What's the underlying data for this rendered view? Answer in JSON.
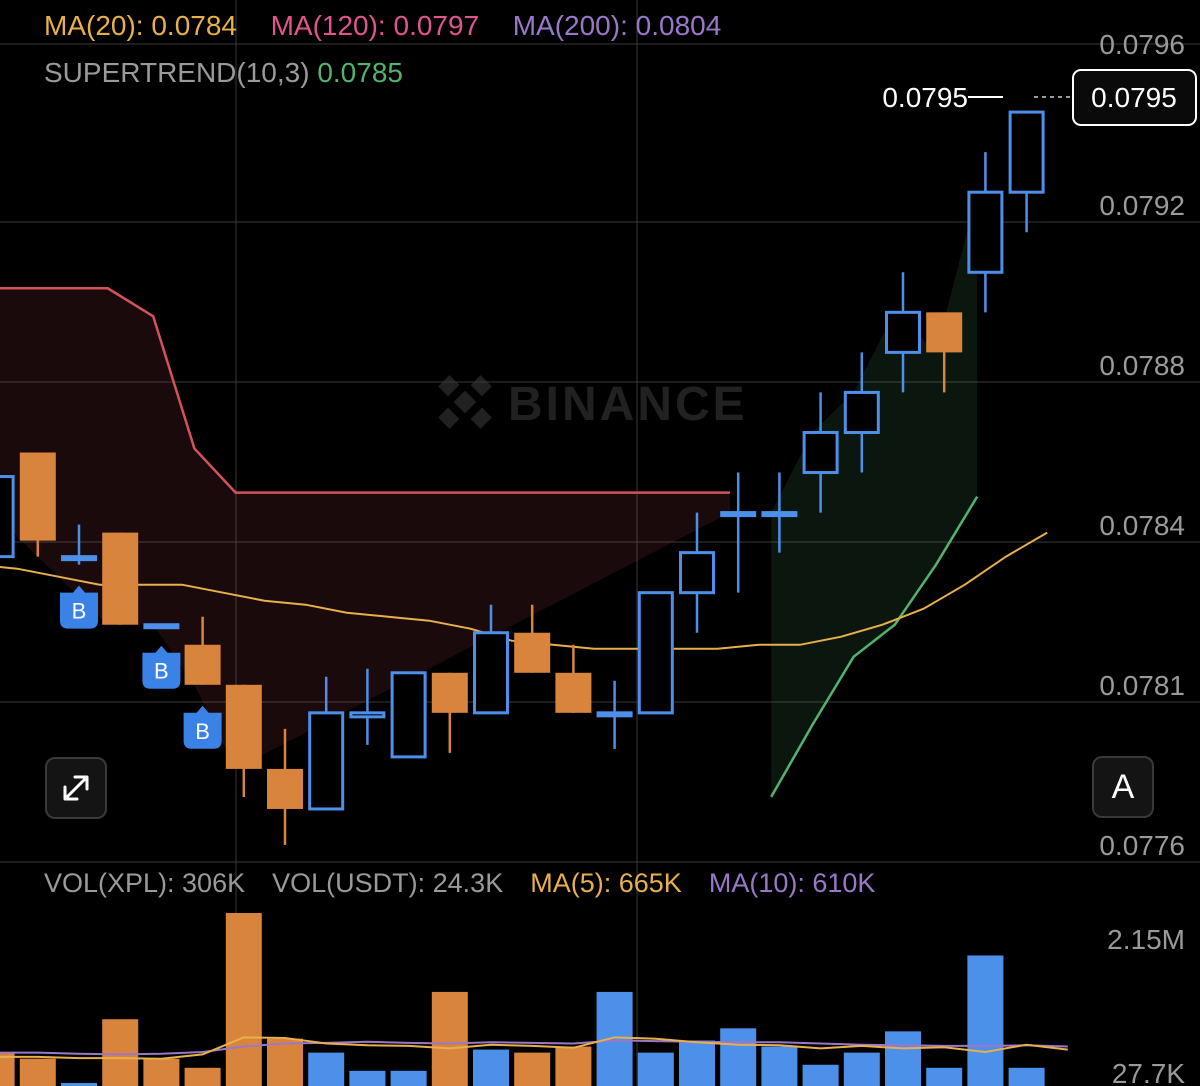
{
  "indicators": {
    "ma20": {
      "label": "MA(20): ",
      "value": "0.0784",
      "color": "#e8b04a"
    },
    "ma120": {
      "label": "MA(120): ",
      "value": "0.0797",
      "color": "#e0558f"
    },
    "ma200": {
      "label": "MA(200): ",
      "value": "0.0804",
      "color": "#9a78c8"
    },
    "supertrend": {
      "label": "SUPERTREND(10,3) ",
      "value": "0.0785",
      "label_color": "#9a9a9a",
      "value_color": "#52b46c"
    }
  },
  "volume_header": {
    "vol_xpl": "VOL(XPL): 306K",
    "vol_usdt": "VOL(USDT): 24.3K",
    "ma5": "MA(5): 665K",
    "ma10": "MA(10): 610K"
  },
  "watermark": "BINANCE",
  "current_price": {
    "label": "0.0795",
    "tag": "0.0795"
  },
  "auto_button": {
    "label": "A"
  },
  "expand_button": {
    "icon": "expand-icon"
  },
  "colors": {
    "up": "#4c90ea",
    "down": "#d8843c",
    "supertrend_up": "#52b46c",
    "supertrend_down": "#d6525a",
    "ma_line": "#e8b04a",
    "vol_ma10": "#9a78c8",
    "grid": "#3a3a3a",
    "axis_text": "#9a9a9a",
    "buy_marker": "#3b82e6"
  },
  "chart_data": {
    "type": "candlestick",
    "price_axis": {
      "ticks": [
        "0.0796",
        "0.0792",
        "0.0788",
        "0.0784",
        "0.0781",
        "0.0776"
      ]
    },
    "volume_axis": {
      "ticks": [
        "2.15M",
        "27.7K"
      ]
    },
    "candles": [
      {
        "o": 0.07832,
        "c": 0.07852,
        "h": 0.07852,
        "l": 0.07832
      },
      {
        "o": 0.07858,
        "c": 0.07836,
        "h": 0.07858,
        "l": 0.07832
      },
      {
        "o": 0.07832,
        "c": 0.07832,
        "h": 0.0784,
        "l": 0.0783
      },
      {
        "o": 0.07838,
        "c": 0.07815,
        "h": 0.07838,
        "l": 0.07815
      },
      {
        "o": 0.07815,
        "c": 0.07815,
        "h": 0.07815,
        "l": 0.07815
      },
      {
        "o": 0.0781,
        "c": 0.078,
        "h": 0.07817,
        "l": 0.078
      },
      {
        "o": 0.078,
        "c": 0.07779,
        "h": 0.078,
        "l": 0.07772
      },
      {
        "o": 0.07779,
        "c": 0.07769,
        "h": 0.07789,
        "l": 0.0776
      },
      {
        "o": 0.07769,
        "c": 0.07793,
        "h": 0.07802,
        "l": 0.07769
      },
      {
        "o": 0.07792,
        "c": 0.07793,
        "h": 0.07804,
        "l": 0.07785
      },
      {
        "o": 0.07782,
        "c": 0.07803,
        "h": 0.07803,
        "l": 0.07782
      },
      {
        "o": 0.07803,
        "c": 0.07793,
        "h": 0.07803,
        "l": 0.07783
      },
      {
        "o": 0.07793,
        "c": 0.07813,
        "h": 0.0782,
        "l": 0.07793
      },
      {
        "o": 0.07813,
        "c": 0.07803,
        "h": 0.0782,
        "l": 0.07803
      },
      {
        "o": 0.07803,
        "c": 0.07793,
        "h": 0.0781,
        "l": 0.07793
      },
      {
        "o": 0.07793,
        "c": 0.07793,
        "h": 0.07801,
        "l": 0.07784
      },
      {
        "o": 0.07793,
        "c": 0.07823,
        "h": 0.07823,
        "l": 0.07793
      },
      {
        "o": 0.07823,
        "c": 0.07833,
        "h": 0.07843,
        "l": 0.07813
      },
      {
        "o": 0.07843,
        "c": 0.07843,
        "h": 0.07853,
        "l": 0.07823
      },
      {
        "o": 0.07843,
        "c": 0.07843,
        "h": 0.07853,
        "l": 0.07833
      },
      {
        "o": 0.07853,
        "c": 0.07863,
        "h": 0.07873,
        "l": 0.07843
      },
      {
        "o": 0.07863,
        "c": 0.07873,
        "h": 0.07883,
        "l": 0.07853
      },
      {
        "o": 0.07883,
        "c": 0.07893,
        "h": 0.07903,
        "l": 0.07873
      },
      {
        "o": 0.07893,
        "c": 0.07883,
        "h": 0.07893,
        "l": 0.07873
      },
      {
        "o": 0.07903,
        "c": 0.07923,
        "h": 0.07933,
        "l": 0.07893
      },
      {
        "o": 0.07923,
        "c": 0.07943,
        "h": 0.07943,
        "l": 0.07913
      }
    ],
    "volumes": [
      {
        "v": 0.55,
        "dir": "down"
      },
      {
        "v": 0.45,
        "dir": "down"
      },
      {
        "v": 0.05,
        "dir": "up"
      },
      {
        "v": 1.1,
        "dir": "down"
      },
      {
        "v": 0.45,
        "dir": "down"
      },
      {
        "v": 0.3,
        "dir": "down"
      },
      {
        "v": 2.85,
        "dir": "down"
      },
      {
        "v": 0.78,
        "dir": "down"
      },
      {
        "v": 0.55,
        "dir": "up"
      },
      {
        "v": 0.25,
        "dir": "up"
      },
      {
        "v": 0.25,
        "dir": "up"
      },
      {
        "v": 1.55,
        "dir": "down"
      },
      {
        "v": 0.6,
        "dir": "up"
      },
      {
        "v": 0.55,
        "dir": "down"
      },
      {
        "v": 0.65,
        "dir": "down"
      },
      {
        "v": 1.55,
        "dir": "up"
      },
      {
        "v": 0.55,
        "dir": "up"
      },
      {
        "v": 0.75,
        "dir": "up"
      },
      {
        "v": 0.95,
        "dir": "up"
      },
      {
        "v": 0.65,
        "dir": "up"
      },
      {
        "v": 0.35,
        "dir": "up"
      },
      {
        "v": 0.55,
        "dir": "up"
      },
      {
        "v": 0.9,
        "dir": "up"
      },
      {
        "v": 0.3,
        "dir": "up"
      },
      {
        "v": 2.15,
        "dir": "up"
      },
      {
        "v": 0.3,
        "dir": "up"
      }
    ],
    "vol_ma5": [
      0.48,
      0.48,
      0.46,
      0.46,
      0.45,
      0.52,
      0.8,
      0.79,
      0.7,
      0.67,
      0.66,
      0.62,
      0.68,
      0.66,
      0.63,
      0.8,
      0.78,
      0.72,
      0.68,
      0.67,
      0.62,
      0.66,
      0.62,
      0.64,
      0.56,
      0.68,
      0.6
    ],
    "vol_ma10": [
      0.55,
      0.55,
      0.53,
      0.52,
      0.53,
      0.56,
      0.65,
      0.7,
      0.71,
      0.73,
      0.71,
      0.7,
      0.72,
      0.71,
      0.7,
      0.75,
      0.74,
      0.73,
      0.72,
      0.72,
      0.7,
      0.68,
      0.67,
      0.66,
      0.66,
      0.67,
      0.65
    ],
    "ma20": [
      0.0783,
      0.07829,
      0.07827,
      0.07825,
      0.07825,
      0.07825,
      0.07823,
      0.07821,
      0.0782,
      0.07818,
      0.07817,
      0.07816,
      0.07814,
      0.07811,
      0.0781,
      0.07809,
      0.07809,
      0.07809,
      0.07809,
      0.0781,
      0.0781,
      0.07812,
      0.07815,
      0.07819,
      0.07825,
      0.07832,
      0.07838
    ],
    "supertrend_down": [
      {
        "i": -0.5,
        "y": 0.07899
      },
      {
        "i": 3.2,
        "y": 0.07899
      },
      {
        "i": 4.3,
        "y": 0.07892
      },
      {
        "i": 5.3,
        "y": 0.07859
      },
      {
        "i": 6.3,
        "y": 0.07848
      },
      {
        "i": 18.3,
        "y": 0.07848
      }
    ],
    "supertrend_up": [
      {
        "i": 19.3,
        "y": 0.07772
      },
      {
        "i": 20.3,
        "y": 0.0779
      },
      {
        "i": 21.3,
        "y": 0.07807
      },
      {
        "i": 22.3,
        "y": 0.07815
      },
      {
        "i": 23.3,
        "y": 0.0783
      },
      {
        "i": 24.3,
        "y": 0.07847
      }
    ],
    "buy_markers": [
      2,
      4,
      5
    ]
  }
}
